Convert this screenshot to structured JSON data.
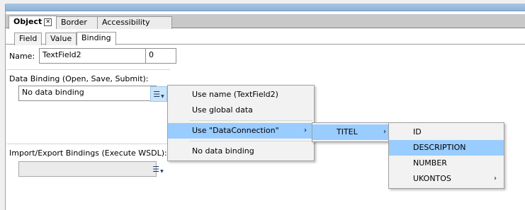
{
  "tabs": [
    {
      "label": "Object",
      "active": true,
      "closable": true
    },
    {
      "label": "Border",
      "active": false
    },
    {
      "label": "Accessibility",
      "active": false
    }
  ],
  "subtabs": [
    {
      "label": "Field",
      "active": false
    },
    {
      "label": "Value",
      "active": false
    },
    {
      "label": "Binding",
      "active": true
    }
  ],
  "name": {
    "label": "Name:",
    "value": "TextField2",
    "index": "0"
  },
  "data_binding": {
    "label": "Data Binding (Open, Save, Submit):",
    "value": "No data binding"
  },
  "import_export": {
    "label": "Import/Export Bindings (Execute WSDL):",
    "value": ""
  },
  "menu1": {
    "items": [
      {
        "label": "Use name (TextField2)"
      },
      {
        "label": "Use global data"
      },
      {
        "label": "Use \"DataConnection\"",
        "submenu": true,
        "highlighted": true
      },
      {
        "label": "No data binding"
      }
    ]
  },
  "menu2": {
    "items": [
      {
        "label": "TITEL",
        "submenu": true,
        "highlighted": true
      }
    ]
  },
  "menu3": {
    "items": [
      {
        "label": "ID"
      },
      {
        "label": "DESCRIPTION",
        "highlighted": true
      },
      {
        "label": "NUMBER"
      },
      {
        "label": "UKONTOS",
        "submenu": true
      }
    ]
  },
  "icons": {
    "list_button": "list-dropdown-icon",
    "submenu": "chevron-right-icon",
    "tab_close": "close-icon"
  },
  "colors": {
    "highlight": "#99ccff",
    "titlebar": "#a9c6e3",
    "menu_bg": "#f2f2f2"
  }
}
